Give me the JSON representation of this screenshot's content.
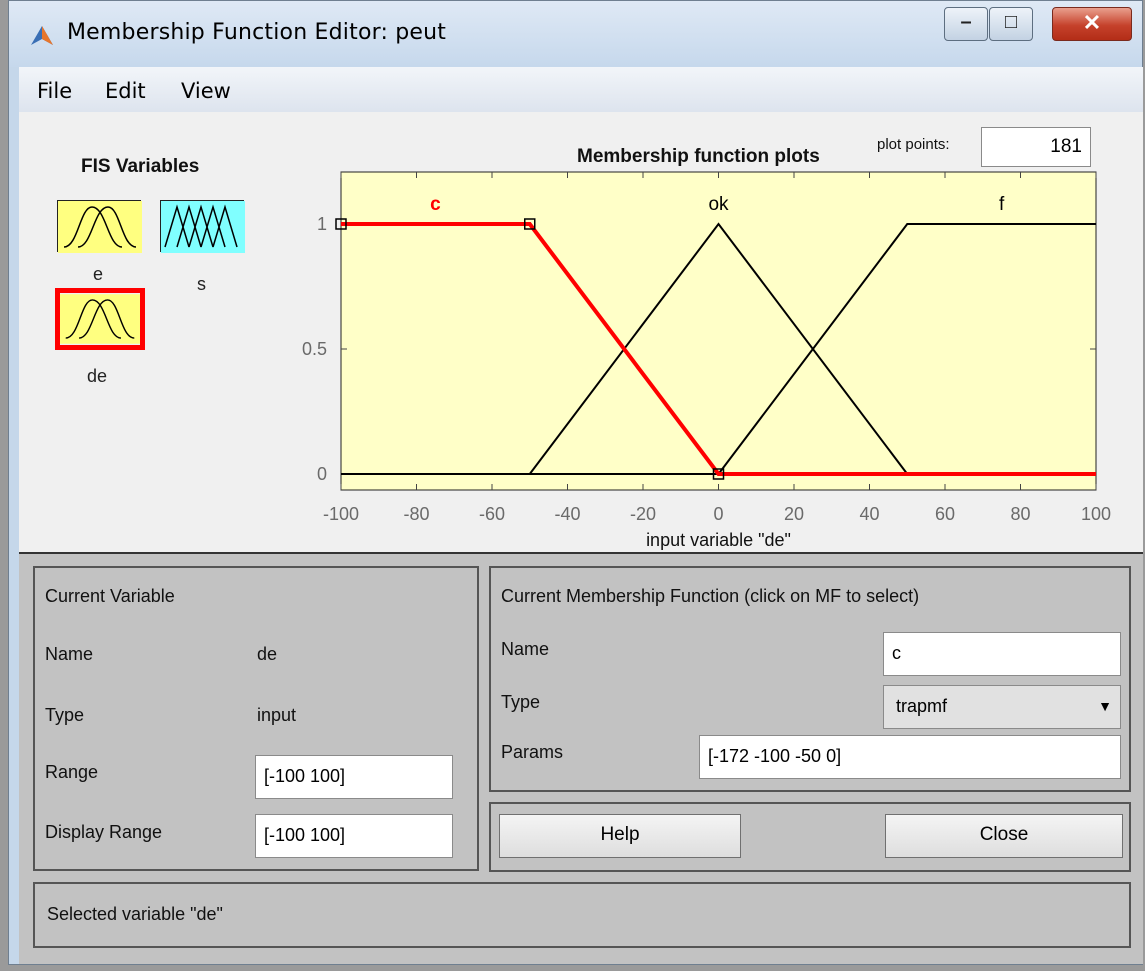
{
  "window": {
    "title": "Membership Function Editor: peut"
  },
  "menu": [
    "File",
    "Edit",
    "View"
  ],
  "fis_variables": {
    "title": "FIS Variables",
    "items": [
      {
        "name": "e",
        "kind": "input",
        "color": "#ffff80"
      },
      {
        "name": "s",
        "kind": "output",
        "color": "#80ffff"
      },
      {
        "name": "de",
        "kind": "input",
        "color": "#ffff80",
        "selected": true
      }
    ]
  },
  "plot": {
    "title": "Membership function plots",
    "plot_points_label": "plot points:",
    "plot_points_value": "181",
    "xlabel": "input variable \"de\""
  },
  "chart_data": {
    "type": "line",
    "title": "Membership function plots",
    "xlabel": "input variable \"de\"",
    "ylabel": "",
    "xlim": [
      -100,
      100
    ],
    "ylim": [
      0,
      1
    ],
    "x_ticks": [
      "-100",
      "-80",
      "-60",
      "-40",
      "-20",
      "0",
      "20",
      "40",
      "60",
      "80",
      "100"
    ],
    "y_ticks": [
      "0",
      "0.5",
      "1"
    ],
    "background": "#ffffc8",
    "series": [
      {
        "name": "c",
        "color": "#ff0000",
        "selected": true,
        "points": [
          [
            -100,
            1
          ],
          [
            -50,
            1
          ],
          [
            0,
            0
          ],
          [
            100,
            0
          ]
        ]
      },
      {
        "name": "ok",
        "color": "#000000",
        "points": [
          [
            -100,
            0
          ],
          [
            -50,
            0
          ],
          [
            0,
            1
          ],
          [
            50,
            0
          ],
          [
            100,
            0
          ]
        ]
      },
      {
        "name": "f",
        "color": "#000000",
        "points": [
          [
            -100,
            0
          ],
          [
            0,
            0
          ],
          [
            50,
            1
          ],
          [
            100,
            1
          ]
        ]
      }
    ],
    "labels": [
      {
        "text": "c",
        "x": -75,
        "color": "#ff0000"
      },
      {
        "text": "ok",
        "x": 0,
        "color": "#000000"
      },
      {
        "text": "f",
        "x": 75,
        "color": "#000000"
      }
    ]
  },
  "current_variable": {
    "title": "Current Variable",
    "name_label": "Name",
    "name_value": "de",
    "type_label": "Type",
    "type_value": "input",
    "range_label": "Range",
    "range_value": "[-100 100]",
    "display_range_label": "Display Range",
    "display_range_value": "[-100 100]"
  },
  "current_mf": {
    "title": "Current Membership Function (click on MF to select)",
    "name_label": "Name",
    "name_value": "c",
    "type_label": "Type",
    "type_value": "trapmf",
    "params_label": "Params",
    "params_value": "[-172 -100 -50 0]"
  },
  "buttons": {
    "help": "Help",
    "close": "Close"
  },
  "status": "Selected variable \"de\""
}
